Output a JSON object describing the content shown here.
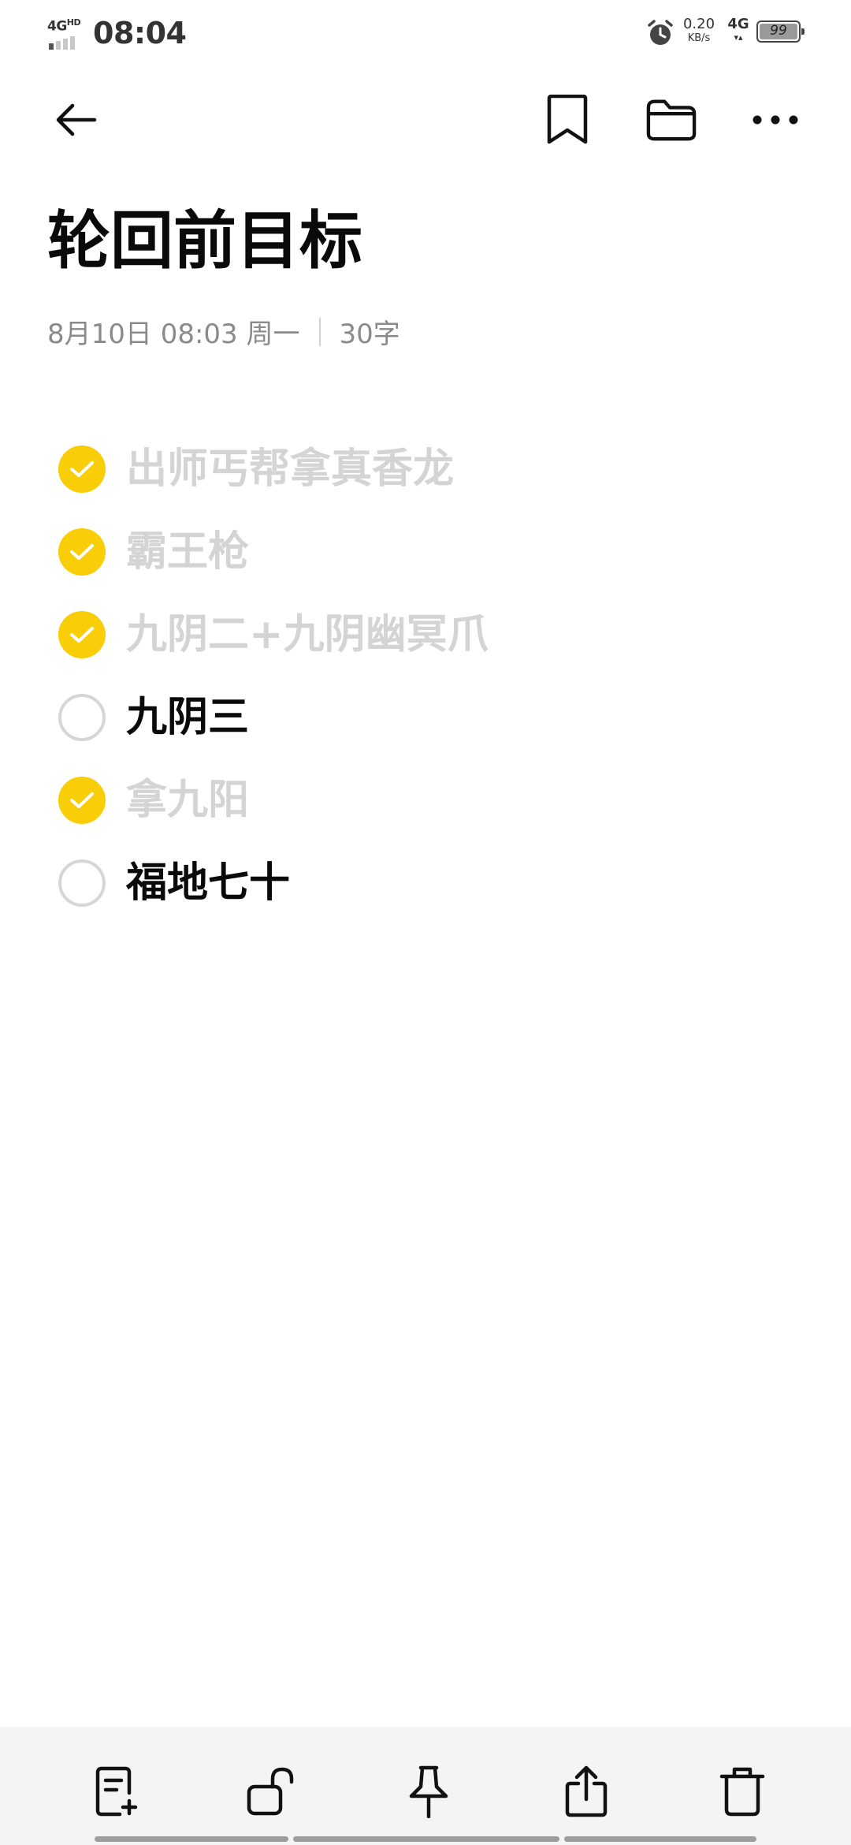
{
  "status_bar": {
    "network_label": "4G",
    "network_sup": "HD",
    "time": "08:04",
    "speed_value": "0.20",
    "speed_unit": "KB/s",
    "mobile_data": "4G",
    "mobile_arrows": "▾▴",
    "battery_level": "99"
  },
  "toolbar": {
    "back_icon": "arrow-left-icon",
    "bookmark_icon": "bookmark-icon",
    "folder_icon": "folder-icon",
    "more_icon": "more-dots-icon"
  },
  "note": {
    "title": "轮回前目标",
    "date": "8月10日 08:03 周一",
    "word_count": "30字"
  },
  "checklist": [
    {
      "text": "出师丐帮拿真香龙",
      "checked": true
    },
    {
      "text": "霸王枪",
      "checked": true
    },
    {
      "text": "九阴二+九阴幽冥爪",
      "checked": true
    },
    {
      "text": "九阴三",
      "checked": false
    },
    {
      "text": "拿九阳",
      "checked": true
    },
    {
      "text": "福地七十",
      "checked": false
    }
  ],
  "colors": {
    "accent": "#f9cd07",
    "done_text": "#d4d4d4",
    "todo_text": "#0a0a0a",
    "meta_text": "#8a8a8a",
    "bottom_bar_bg": "#f4f4f4"
  },
  "bottom_bar": {
    "icons": [
      "note-add-icon",
      "unlock-icon",
      "pin-icon",
      "share-icon",
      "trash-icon"
    ]
  }
}
